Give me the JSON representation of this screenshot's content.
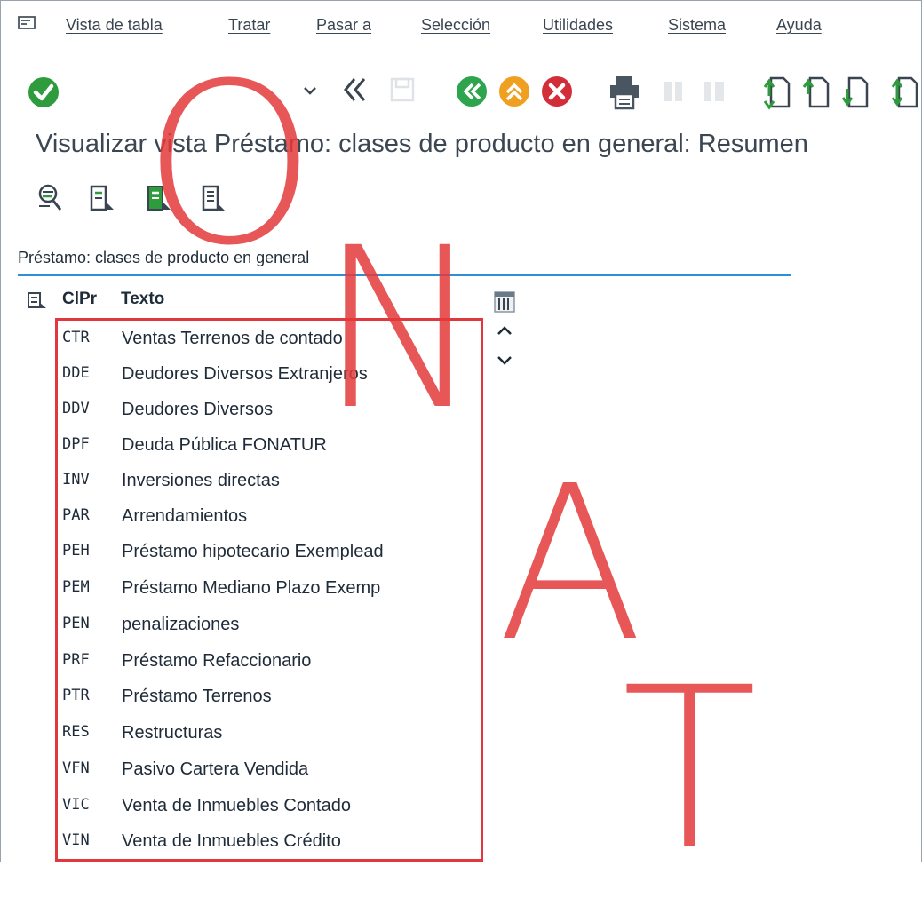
{
  "menu": {
    "items": [
      "Vista de tabla",
      "Tratar",
      "Pasar a",
      "Selección",
      "Utilidades",
      "Sistema",
      "Ayuda"
    ]
  },
  "page": {
    "title": "Visualizar vista Préstamo: clases de producto en general: Resumen"
  },
  "section": {
    "title": "Préstamo: clases de producto en general"
  },
  "table": {
    "headers": {
      "key": "ClPr",
      "text": "Texto"
    },
    "rows": [
      {
        "key": "CTR",
        "text": "Ventas Terrenos de contado"
      },
      {
        "key": "DDE",
        "text": "Deudores Diversos Extranjeros"
      },
      {
        "key": "DDV",
        "text": "Deudores Diversos"
      },
      {
        "key": "DPF",
        "text": "Deuda Pública FONATUR"
      },
      {
        "key": "INV",
        "text": "Inversiones directas"
      },
      {
        "key": "PAR",
        "text": "Arrendamientos"
      },
      {
        "key": "PEH",
        "text": "Préstamo hipotecario Exemplead"
      },
      {
        "key": "PEM",
        "text": "Préstamo Mediano Plazo Exemp"
      },
      {
        "key": "PEN",
        "text": "penalizaciones"
      },
      {
        "key": "PRF",
        "text": "Préstamo Refaccionario"
      },
      {
        "key": "PTR",
        "text": "Préstamo Terrenos"
      },
      {
        "key": "RES",
        "text": "Restructuras"
      },
      {
        "key": "VFN",
        "text": "Pasivo Cartera Vendida"
      },
      {
        "key": "VIC",
        "text": "Venta de Inmuebles Contado"
      },
      {
        "key": "VIN",
        "text": "Venta de Inmuebles Crédito"
      }
    ]
  },
  "watermark": {
    "letters": [
      "O",
      "N",
      "A",
      "T"
    ]
  },
  "colors": {
    "accent_blue": "#2f8fd6",
    "highlight_red": "#e0383d",
    "ok_green": "#2e9b3d",
    "back_green": "#2ea44f",
    "up_orange": "#f0a020",
    "cancel_red": "#d22e3a"
  },
  "icons": [
    "menu-icon",
    "enter-check-icon",
    "dropdown-chevron-icon",
    "back-double-chevron-icon",
    "save-icon",
    "back-icon",
    "exit-icon",
    "cancel-icon",
    "print-icon",
    "find-icon",
    "find-next-icon",
    "first-page-icon",
    "previous-page-icon",
    "next-page-icon",
    "last-page-icon",
    "display-change-icon",
    "details-icon",
    "copy-as-icon",
    "select-all-icon",
    "column-settings-icon",
    "scroll-up-icon",
    "scroll-down-icon"
  ]
}
